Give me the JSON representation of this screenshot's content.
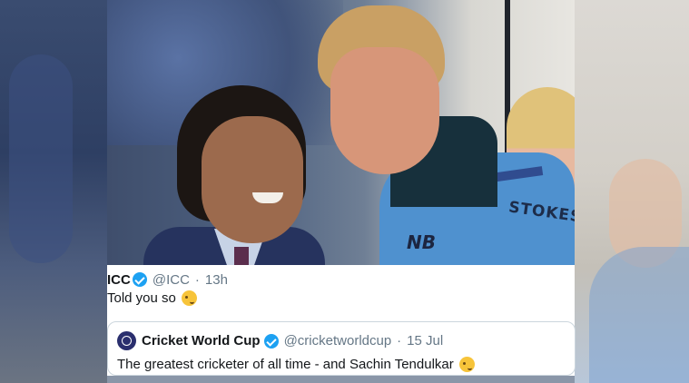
{
  "photo": {
    "jersey_name": "STOKES",
    "jersey_logo": "NB"
  },
  "tweet": {
    "name": "ICC",
    "handle": "@ICC",
    "time": "13h",
    "text": "Told you so",
    "emoji": "winking-face"
  },
  "quoted_tweet": {
    "name": "Cricket World Cup",
    "handle": "@cricketworldcup",
    "date": "15 Jul",
    "text": "The greatest cricketer of all time - and Sachin Tendulkar",
    "emoji": "winking-face"
  },
  "colors": {
    "verified": "#1da1f2",
    "text": "#14171a",
    "meta": "#657786",
    "border": "#ccd6dd"
  }
}
